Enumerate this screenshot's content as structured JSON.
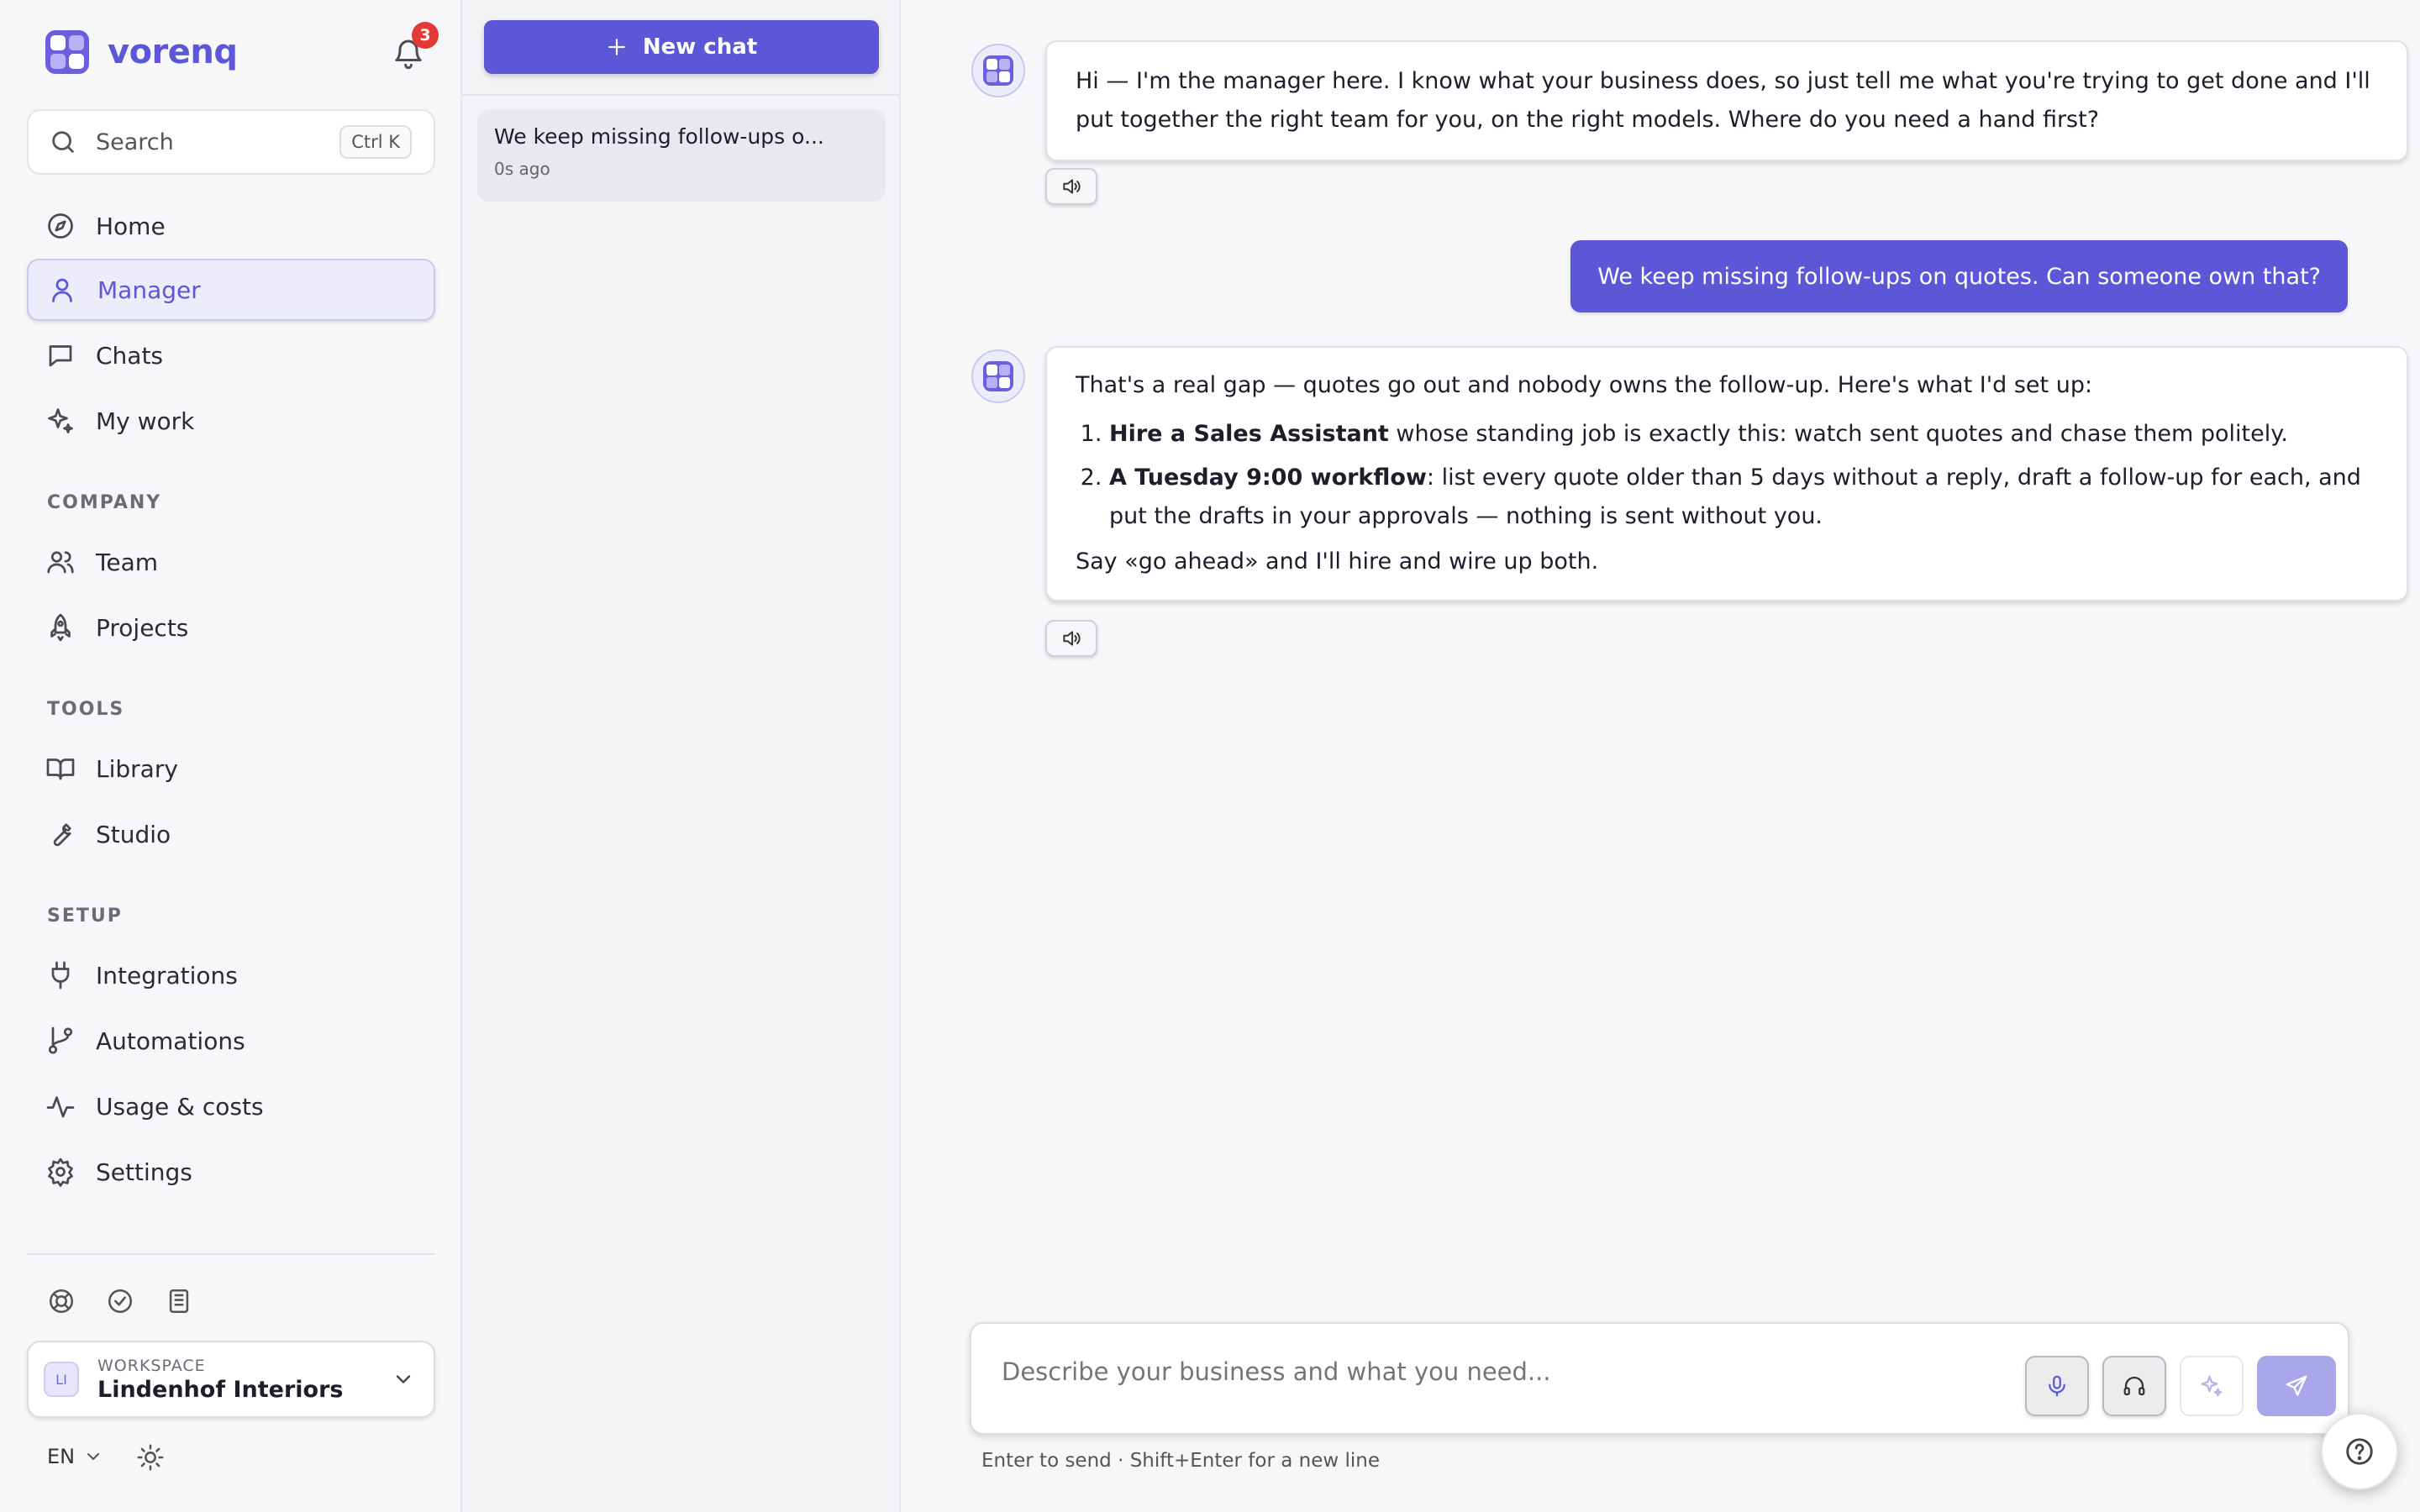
{
  "brand": {
    "name": "vorenq",
    "accent": "#5b57d6"
  },
  "notifications": {
    "count": "3"
  },
  "search": {
    "label": "Search",
    "shortcut": "Ctrl K"
  },
  "nav": {
    "home": "Home",
    "manager": "Manager",
    "chats": "Chats",
    "my_work": "My work",
    "company_label": "COMPANY",
    "team": "Team",
    "projects": "Projects",
    "tools_label": "TOOLS",
    "library": "Library",
    "studio": "Studio",
    "setup_label": "SETUP",
    "integrations": "Integrations",
    "automations": "Automations",
    "usage": "Usage & costs",
    "settings": "Settings"
  },
  "workspace": {
    "initials": "LI",
    "label": "WORKSPACE",
    "name": "Lindenhof Interiors"
  },
  "language": "EN",
  "chatlist": {
    "new_chat": "New chat",
    "items": [
      {
        "title": "We keep missing follow-ups o...",
        "time": "0s ago"
      }
    ]
  },
  "conversation": {
    "bot1": "Hi — I'm the manager here. I know what your business does, so just tell me what you're trying to get done and I'll put together the right team for you, on the right models. Where do you need a hand first?",
    "user1": "We keep missing follow-ups on quotes. Can someone own that?",
    "bot2": {
      "intro": "That's a real gap — quotes go out and nobody owns the follow-up. Here's what I'd set up:",
      "item1_bold": "Hire a Sales Assistant",
      "item1_rest": " whose standing job is exactly this: watch sent quotes and chase them politely.",
      "item2_bold": "A Tuesday 9:00 workflow",
      "item2_rest": ": list every quote older than 5 days without a reply, draft a follow-up for each, and put the drafts in your approvals — nothing is sent without you.",
      "outro": "Say «go ahead» and I'll hire and wire up both."
    }
  },
  "composer": {
    "placeholder": "Describe your business and what you need...",
    "hint": "Enter to send · Shift+Enter for a new line"
  }
}
